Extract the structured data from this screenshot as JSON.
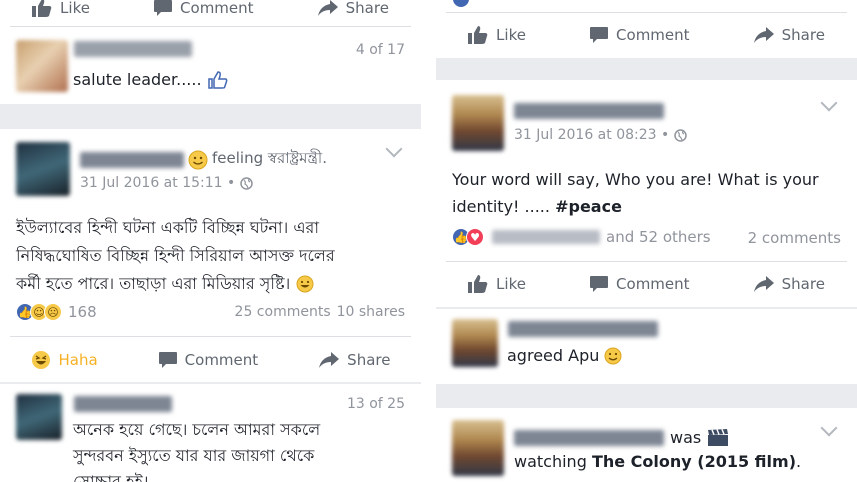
{
  "left": {
    "top_actions": {
      "like": "Like",
      "comment": "Comment",
      "share": "Share"
    },
    "comment1": {
      "counter": "4 of 17",
      "text": "salute leader....."
    },
    "post": {
      "feeling": "feeling স্বরাষ্ট্রমন্ত্রী.",
      "time": "31 Jul 2016 at 15:11 •",
      "body": [
        "ইউল্যাবের হিন্দী ঘটনা একটি বিচ্ছিন্ন ঘটনা। এরা",
        "নিষিদ্ধঘোষিত বিচ্ছিন্ন হিন্দী সিরিয়াল আসক্ত দলের",
        "কর্মী হতে পারে। তাছাড়া এরা মিডিয়ার সৃষ্টি।"
      ],
      "reactions_count": "168",
      "comments": "25 comments",
      "shares": "10 shares",
      "actions": {
        "haha": "Haha",
        "comment": "Comment",
        "share": "Share"
      }
    },
    "comment2": {
      "counter": "13 of 25",
      "body": [
        "অনেক হয়ে গেছে। চলেন আমরা সকলে",
        "সুন্দরবন ইস্যুতে যার যার জায়গা থেকে",
        "সোচ্চার হই।"
      ]
    }
  },
  "right": {
    "top_actions": {
      "like": "Like",
      "comment": "Comment",
      "share": "Share"
    },
    "post": {
      "time": "31 Jul 2016 at 08:23 •",
      "body_line1": "Your word will say, Who you are! What is your",
      "body_line2": "identity!  .....",
      "hashtag": "#peace",
      "others": "and 52 others",
      "comments": "2 comments",
      "actions": {
        "like": "Like",
        "comment": "Comment",
        "share": "Share"
      }
    },
    "comment1": {
      "text": "agreed Apu"
    },
    "post2": {
      "was": "was",
      "watching": "watching",
      "film": "The Colony (2015 film)",
      "period": "."
    }
  },
  "colors": {
    "fb_blue": "#4267b2",
    "haha_yellow": "#f7b125",
    "separator": "#e9ebee",
    "meta_gray": "#90949c"
  }
}
